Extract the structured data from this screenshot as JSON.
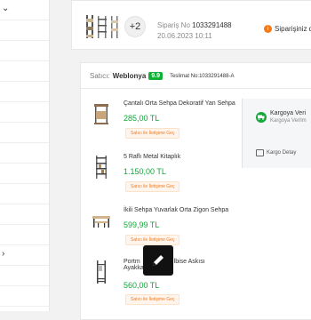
{
  "order": {
    "extra_count": "+2",
    "order_no_label": "Sipariş No",
    "order_no": "1033291488",
    "date": "20.06.2023 10:11",
    "summary_label": "Siparişiniz d"
  },
  "shipment": {
    "seller_label": "Satıcı:",
    "seller_name": "Weblonya",
    "seller_rating": "9.9",
    "delivery_label": "Teslimat No:",
    "delivery_no": "1033291488-A",
    "cargo_status": "Kargoya Veri",
    "cargo_sub": "Kargoya Verilm",
    "cargo_detail": "Kargo Detay"
  },
  "products": [
    {
      "name": "Çantalı Orta Sehpa Dekoratif Yan Sehpa",
      "price": "285,00 TL",
      "button": "Satıcı ile İletişime Geç"
    },
    {
      "name": "5 Raflı Metal Kitaplık",
      "price": "1.150,00 TL",
      "button": "Satıcı ile İletişime Geç"
    },
    {
      "name": "İkili Sehpa Yuvarlak Orta Zigon Sehpa",
      "price": "599,99 TL",
      "button": "Satıcı ile İletişime Geç"
    },
    {
      "name": "Portm",
      "name_tail": "lbise Askısı",
      "name2": "Ayakka",
      "price": "560,00 TL",
      "button": "Satıcı ile İletişime Geç"
    }
  ],
  "colors": {
    "accent": "#f27a1a",
    "price": "#10a839",
    "rating": "#10b236"
  },
  "icons": {
    "summary": "info-icon",
    "cargo": "truck-icon",
    "detail": "box-icon",
    "fab": "pencil-icon"
  }
}
